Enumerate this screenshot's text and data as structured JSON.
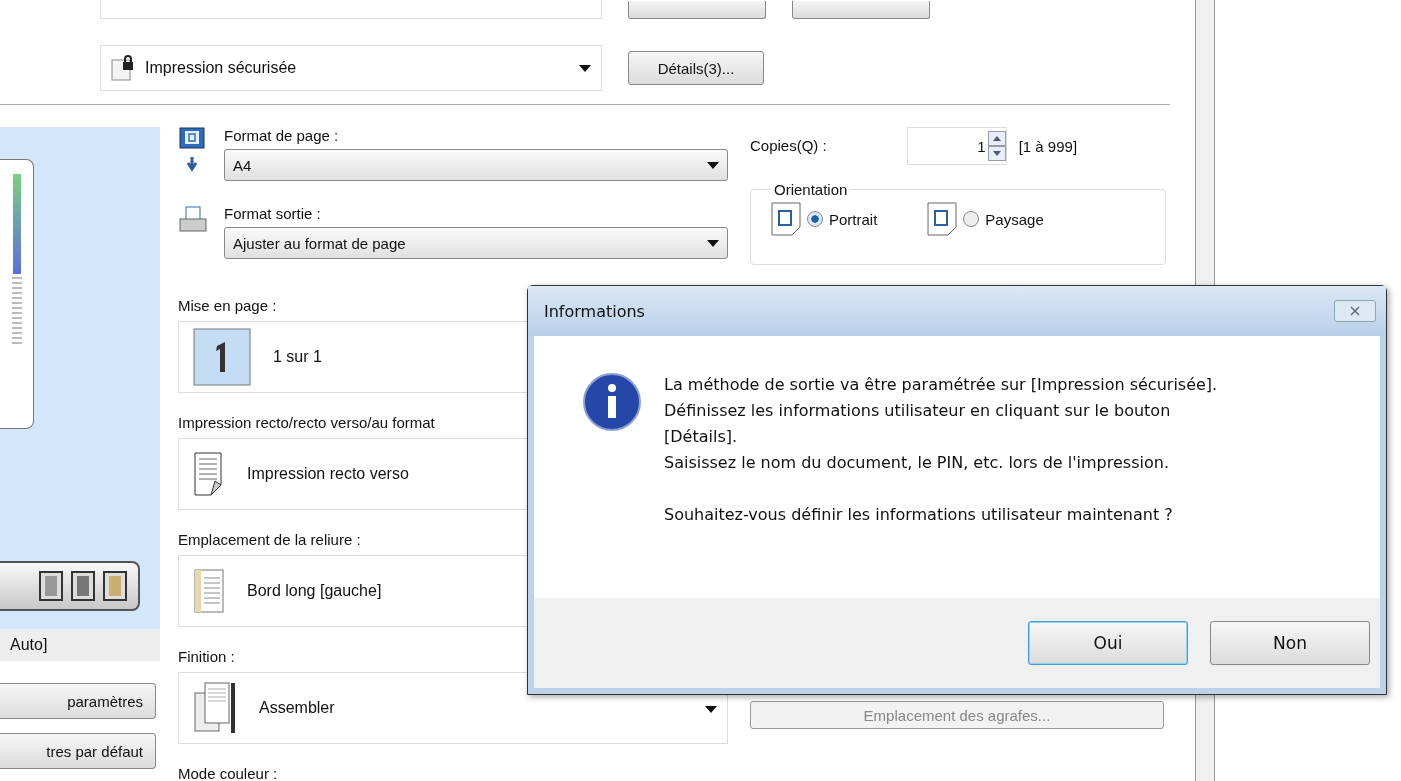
{
  "output_method": {
    "value": "Impression sécurisée"
  },
  "details_button": "Détails(3)...",
  "page_size": {
    "label": "Format de page :",
    "value": "A4"
  },
  "output_size": {
    "label": "Format sortie :",
    "value": "Ajuster au format de page"
  },
  "copies": {
    "label": "Copies(Q) :",
    "value": "1",
    "range": "[1 à 999]"
  },
  "orientation": {
    "title": "Orientation",
    "options": [
      {
        "label": "Portrait",
        "selected": true
      },
      {
        "label": "Paysage",
        "selected": false
      }
    ]
  },
  "sections": [
    {
      "kind": "list",
      "label": "Mise en page :",
      "value": "1 sur 1"
    },
    {
      "kind": "list",
      "label": "Impression recto/recto verso/au format",
      "value": "Impression recto verso"
    },
    {
      "kind": "list",
      "label": "Emplacement de la reliure :",
      "value": "Bord long [gauche]"
    },
    {
      "kind": "dropdown",
      "label": "Finition :",
      "value": "Assembler"
    },
    {
      "kind": "heading",
      "label": "Mode couleur :"
    }
  ],
  "preview": {
    "caption": "Auto]"
  },
  "side_buttons": [
    "paramètres",
    "tres par défaut"
  ],
  "staple_button": "Emplacement des agrafes...",
  "dialog": {
    "title": "Informations",
    "lines": [
      "La méthode de sortie va être paramétrée sur [Impression sécurisée].",
      "Définissez les informations utilisateur en cliquant sur le bouton [Détails].",
      "Saisissez le nom du document, le PIN, etc. lors de l'impression."
    ],
    "question": "Souhaitez-vous définir les informations utilisateur maintenant ?",
    "buttons": [
      {
        "label": "Oui",
        "default": true
      },
      {
        "label": "Non",
        "default": false
      }
    ]
  }
}
